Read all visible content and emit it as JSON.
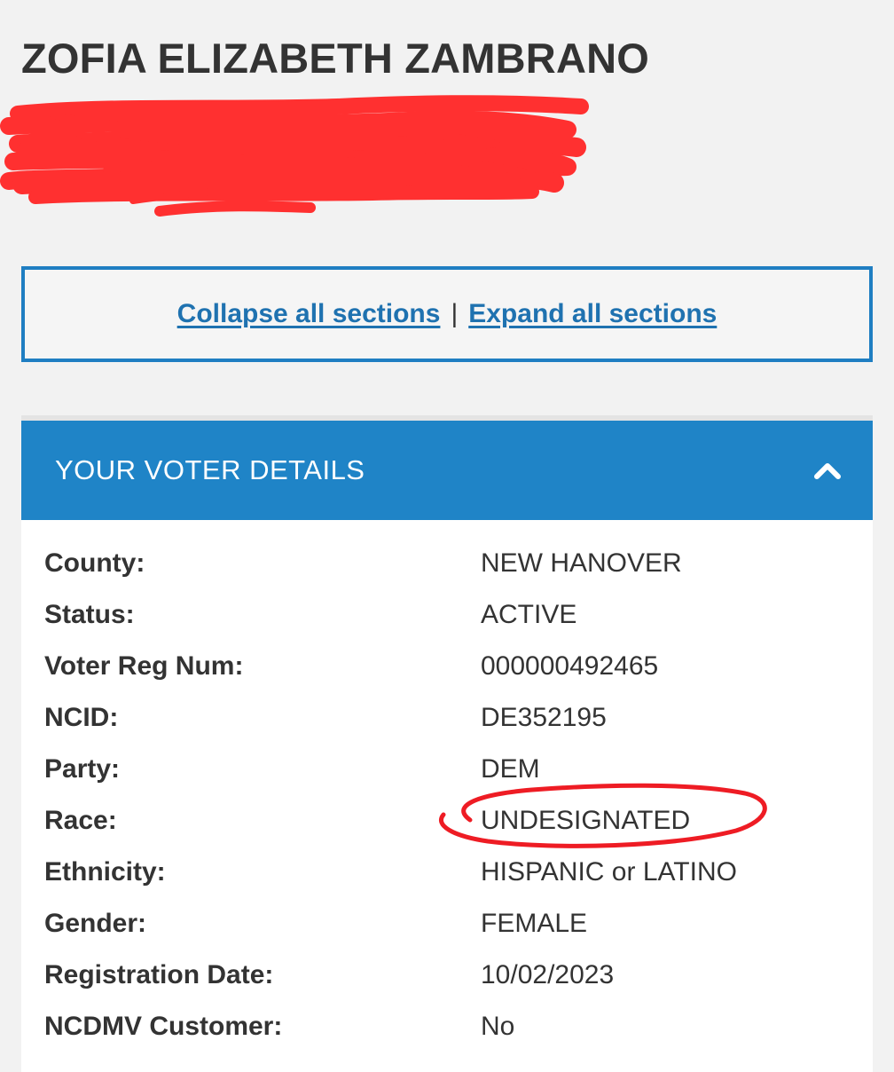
{
  "header": {
    "name": "ZOFIA ELIZABETH ZAMBRANO"
  },
  "redaction": {
    "icon": "red-scribble-redaction",
    "color": "#ff3030"
  },
  "section_controls": {
    "collapse_label": "Collapse all sections",
    "separator": "|",
    "expand_label": "Expand all sections"
  },
  "voter_details": {
    "title": "YOUR VOTER DETAILS",
    "toggle_icon": "chevron-up-icon",
    "header_color": "#1f84c7",
    "rows": [
      {
        "label": "County:",
        "value": "NEW HANOVER"
      },
      {
        "label": "Status:",
        "value": "ACTIVE"
      },
      {
        "label": "Voter Reg Num:",
        "value": "000000492465"
      },
      {
        "label": "NCID:",
        "value": "DE352195"
      },
      {
        "label": "Party:",
        "value": "DEM"
      },
      {
        "label": "Race:",
        "value": "UNDESIGNATED"
      },
      {
        "label": "Ethnicity:",
        "value": "HISPANIC or LATINO"
      },
      {
        "label": "Gender:",
        "value": "FEMALE"
      },
      {
        "label": "Registration Date:",
        "value": "10/02/2023"
      },
      {
        "label": "NCDMV Customer:",
        "value": "No"
      }
    ]
  },
  "annotation": {
    "icon": "red-circle-annotation",
    "color": "#ee1c24"
  }
}
